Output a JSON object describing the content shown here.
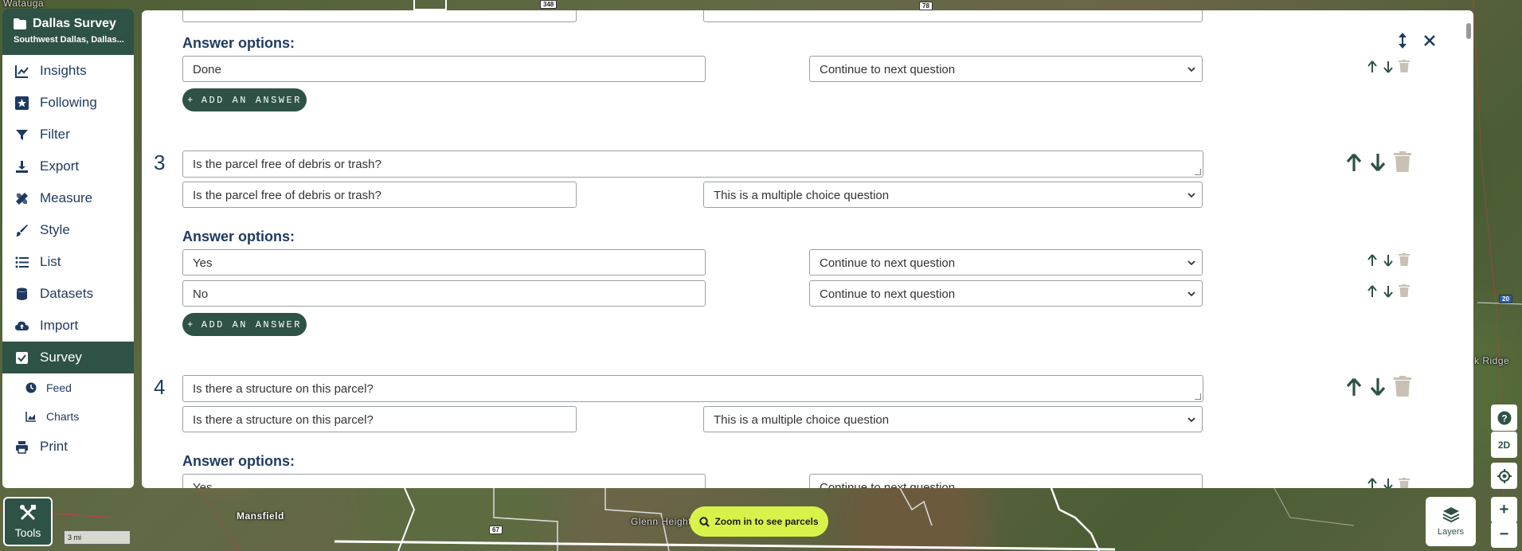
{
  "map": {
    "labels": [
      "Watauga",
      "Mansfield",
      "Glenn Heights",
      "k Ridge"
    ],
    "route_shields": [
      "348",
      "78",
      "67",
      "20"
    ]
  },
  "sidebar": {
    "title": "Dallas Survey",
    "subtitle": "Southwest Dallas, Dallas...",
    "items": [
      {
        "label": "Insights",
        "icon": "chart-line-icon"
      },
      {
        "label": "Following",
        "icon": "star-icon"
      },
      {
        "label": "Filter",
        "icon": "filter-icon"
      },
      {
        "label": "Export",
        "icon": "download-icon"
      },
      {
        "label": "Measure",
        "icon": "ruler-pencil-icon"
      },
      {
        "label": "Style",
        "icon": "paintbrush-icon"
      },
      {
        "label": "List",
        "icon": "list-icon"
      },
      {
        "label": "Datasets",
        "icon": "database-icon"
      },
      {
        "label": "Import",
        "icon": "cloud-upload-icon"
      },
      {
        "label": "Survey",
        "icon": "checkbox-icon",
        "active": true
      }
    ],
    "sub_items": [
      {
        "label": "Feed",
        "icon": "clock-icon"
      },
      {
        "label": "Charts",
        "icon": "area-chart-icon"
      }
    ],
    "print": {
      "label": "Print",
      "icon": "printer-icon"
    }
  },
  "tools": {
    "label": "Tools"
  },
  "scale": {
    "label": "3 mi"
  },
  "zoom_pill": {
    "label": "Zoom in to see parcels"
  },
  "layers": {
    "label": "Layers"
  },
  "map_controls": {
    "help": "?",
    "view_mode": "2D",
    "zoom_in": "+",
    "zoom_out": "−"
  },
  "colors": {
    "primary": "#2e5245",
    "text_dark": "#1e3a5f",
    "accent_lime": "#d9f24a",
    "trash_disabled": "#c9c1b3"
  },
  "panel": {
    "answer_options_heading": "Answer options:",
    "add_answer_label": "ADD AN ANSWER",
    "top_answers": [
      {
        "text": "Done",
        "action": "Continue to next question"
      }
    ],
    "questions": [
      {
        "number": "3",
        "text": "Is the parcel free of debris or trash?",
        "short_text": "Is the parcel free of debris or trash?",
        "type": "This is a multiple choice question",
        "answers": [
          {
            "text": "Yes",
            "action": "Continue to next question"
          },
          {
            "text": "No",
            "action": "Continue to next question"
          }
        ]
      },
      {
        "number": "4",
        "text": "Is there a structure on this parcel?",
        "short_text": "Is there a structure on this parcel?",
        "type": "This is a multiple choice question",
        "answers": [
          {
            "text": "Yes",
            "action": "Continue to next question"
          }
        ]
      }
    ]
  }
}
